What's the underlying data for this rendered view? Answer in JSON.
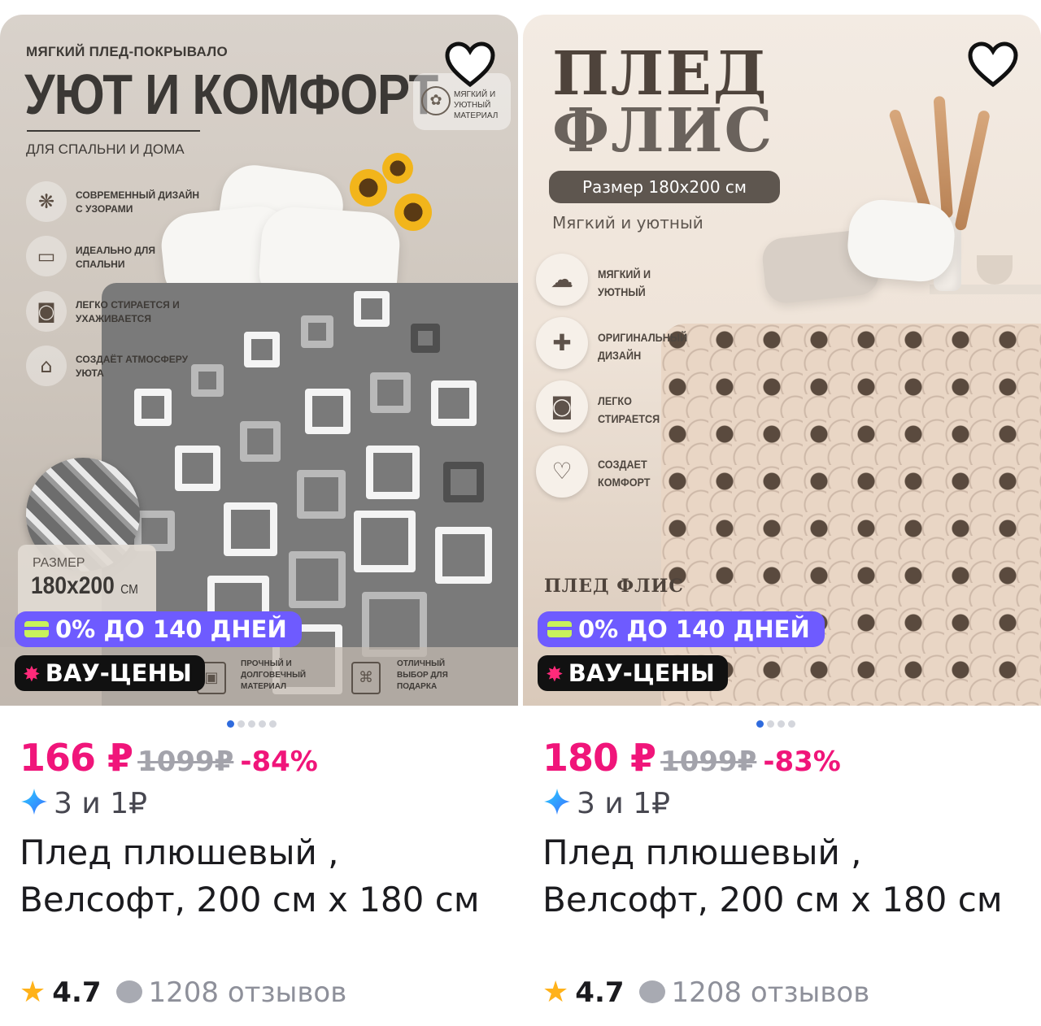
{
  "cards": [
    {
      "image_texts": {
        "kicker": "МЯГКИЙ ПЛЕД-ПОКРЫВАЛО",
        "headline": "УЮТ И КОМФОРТ",
        "subheadline": "ДЛЯ СПАЛЬНИ И ДОМА",
        "badge_top_right": "МЯГКИЙ И УЮТНЫЙ МАТЕРИАЛ",
        "features": [
          {
            "icon": "pattern-icon",
            "text": "СОВРЕМЕННЫЙ ДИЗАЙН С УЗОРАМИ"
          },
          {
            "icon": "bed-icon",
            "text": "ИДЕАЛЬНО ДЛЯ СПАЛЬНИ"
          },
          {
            "icon": "washing-machine-icon",
            "text": "ЛЕГКО СТИРАЕТСЯ И УХАЖИВАЕТСЯ"
          },
          {
            "icon": "house-heart-icon",
            "text": "СОЗДАЁТ АТМОСФЕРУ УЮТА"
          }
        ],
        "size_label": "РАЗМЕР",
        "size_value": "180x200",
        "size_unit": "СМ",
        "strip": [
          {
            "icon": "durable-icon",
            "text": "ПРОЧНЫЙ И ДОЛГОВЕЧНЫЙ МАТЕРИАЛ"
          },
          {
            "icon": "gift-icon",
            "text": "ОТЛИЧНЫЙ ВЫБОР ДЛЯ ПОДАРКА"
          }
        ]
      },
      "badge_installment": "0% ДО 140 ДНЕЙ",
      "badge_wow": "ВАУ-ЦЕНЫ",
      "carousel": {
        "count": 5,
        "active": 0
      },
      "price_now": "166 ₽",
      "price_old": "1099₽",
      "discount": "-84%",
      "installment": "3 и 1₽",
      "name": " Плед плюшевый , Велсофт, 200 см х 180 см",
      "rating": "4.7",
      "reviews": "1208 отзывов"
    },
    {
      "image_texts": {
        "headline_line1": "ПЛЕД",
        "headline_line2": "ФЛИС",
        "size_pill": "Размер 180x200 см",
        "subheadline": "Мягкий и уютный",
        "features": [
          {
            "icon": "cloud-icon",
            "text": "МЯГКИЙ И УЮТНЫЙ"
          },
          {
            "icon": "puzzle-icon",
            "text": "ОРИГИНАЛЬНЫЙ ДИЗАЙН"
          },
          {
            "icon": "washing-machine-icon",
            "text": "ЛЕГКО СТИРАЕТСЯ"
          },
          {
            "icon": "heart-icon",
            "text": "СОЗДАЕТ КОМФОРТ"
          }
        ],
        "plaque": "ПЛЕД ФЛИС"
      },
      "badge_installment": "0% ДО 140 ДНЕЙ",
      "badge_wow": "ВАУ-ЦЕНЫ",
      "carousel": {
        "count": 4,
        "active": 0
      },
      "price_now": "180 ₽",
      "price_old": "1099₽",
      "discount": "-83%",
      "installment": "3 и 1₽",
      "name": " Плед плюшевый , Велсофт, 200 см х 180 см",
      "rating": "4.7",
      "reviews": "1208 отзывов"
    }
  ],
  "colors": {
    "price_accent": "#f0157a",
    "installment_badge": "#6e5bff",
    "wow_badge": "#111111",
    "rating_star": "#ffb21a",
    "active_dot": "#2f6bdd"
  }
}
